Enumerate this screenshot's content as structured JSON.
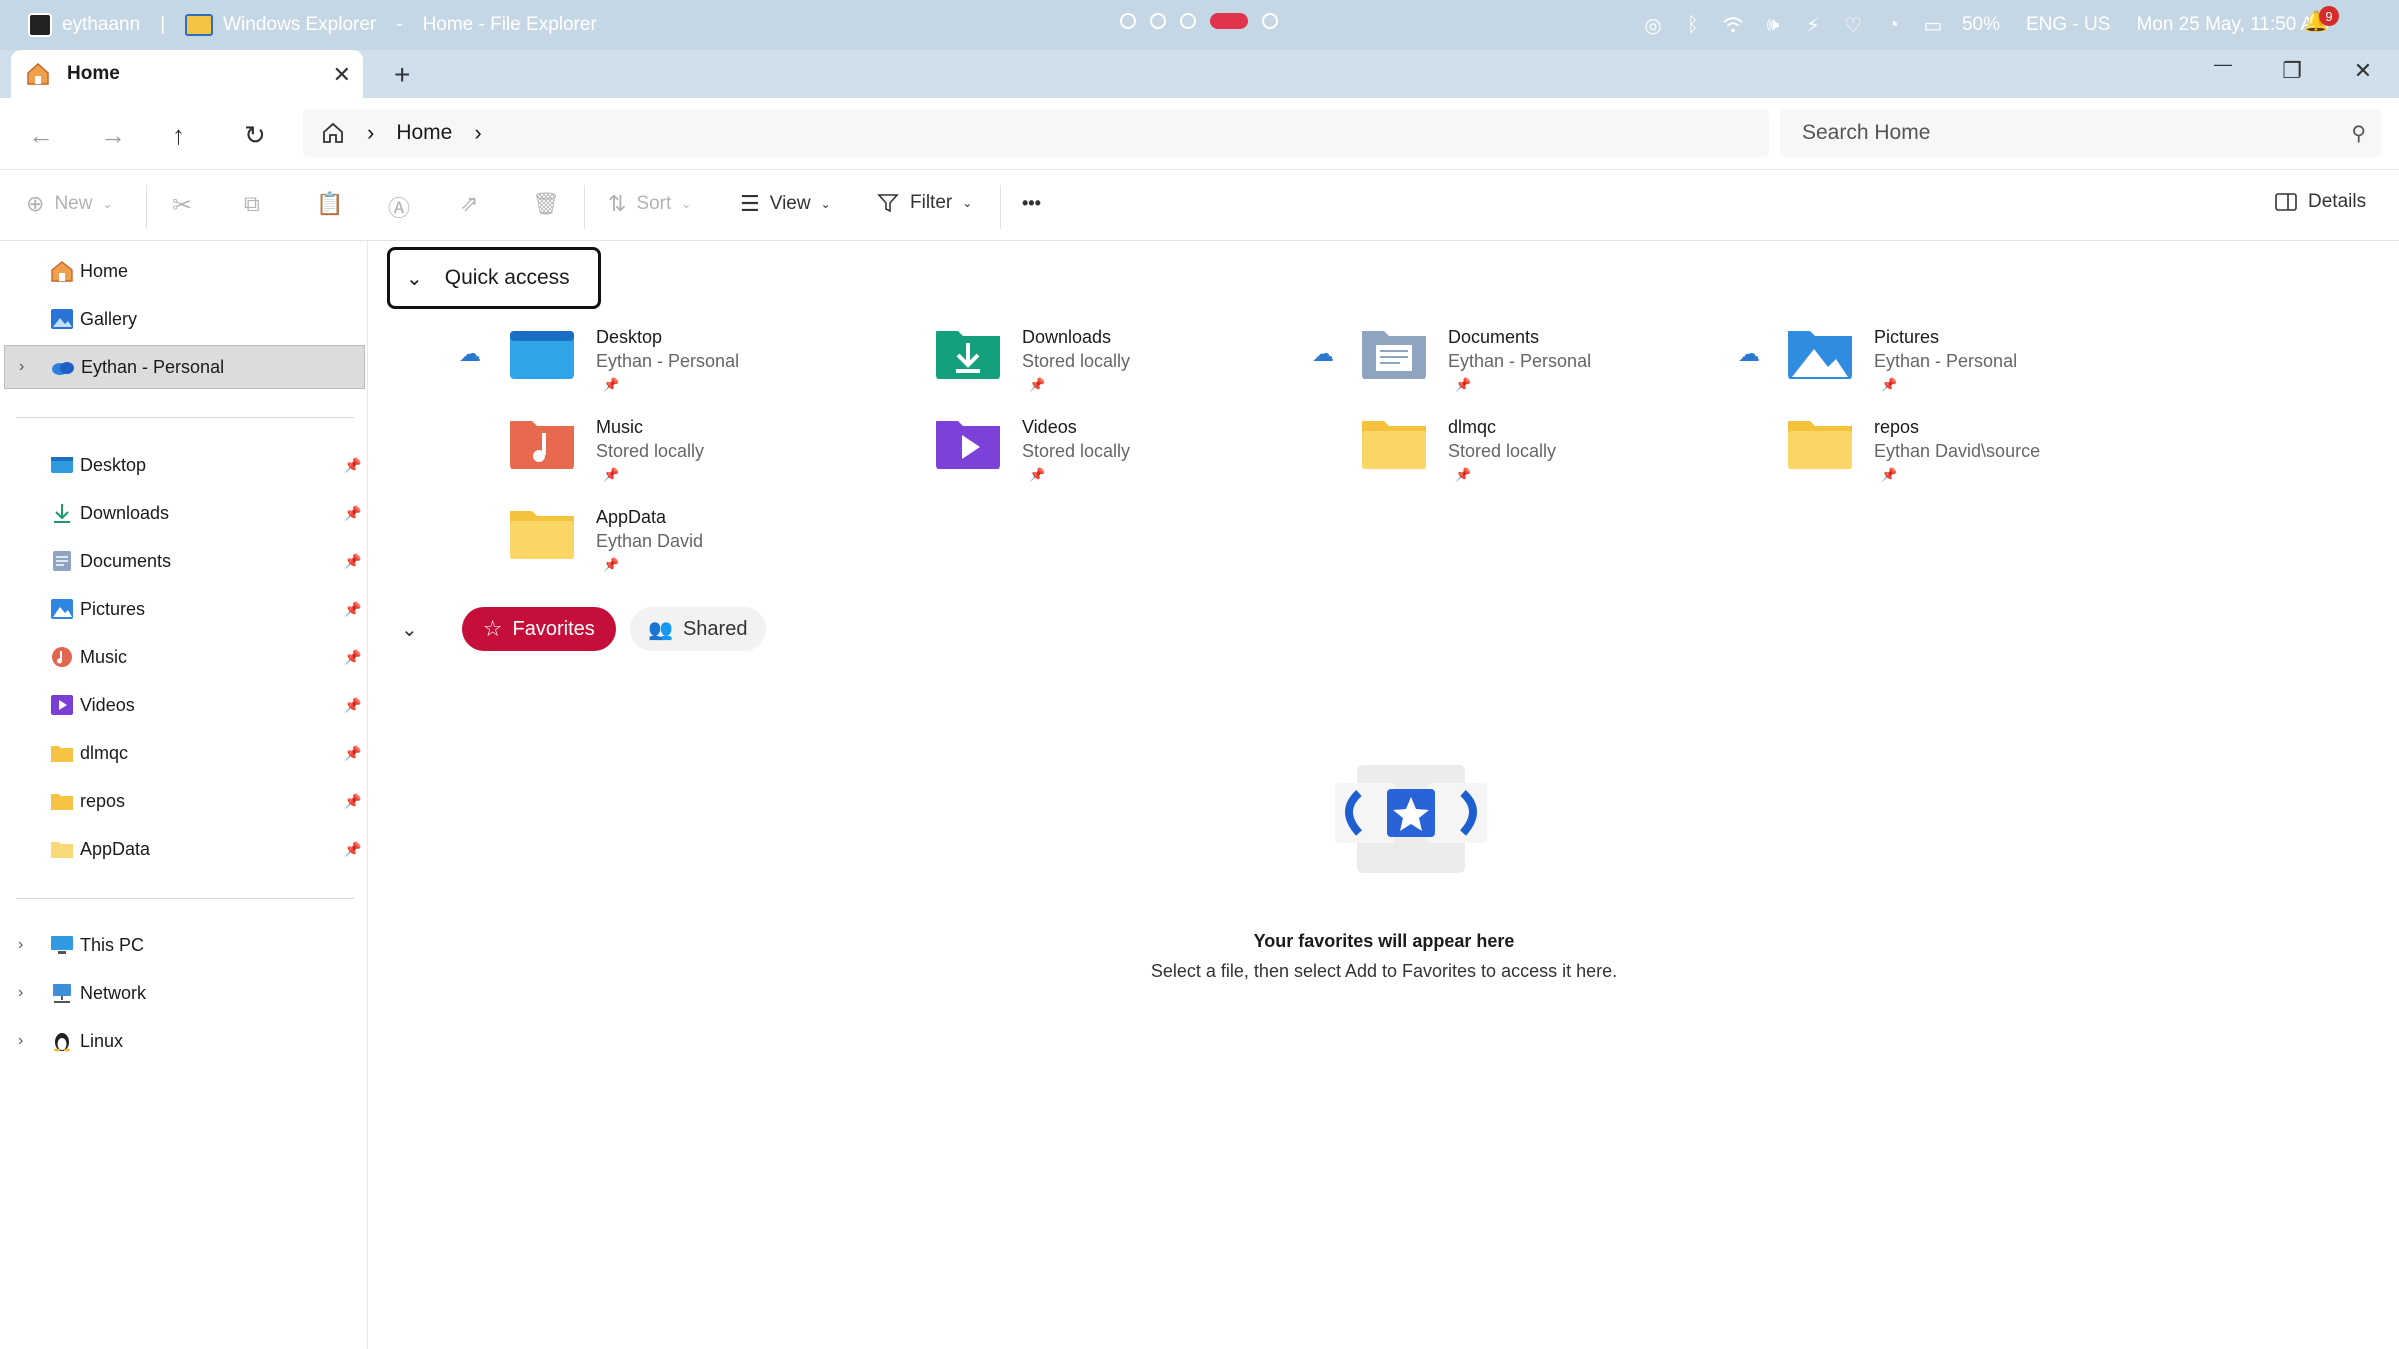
{
  "system_bar": {
    "user": "eythaann",
    "app_name": "Windows Explorer",
    "separator": "-",
    "window_title": "Home - File Explorer",
    "battery": "50%",
    "language": "ENG - US",
    "datetime": "Mon 25 May, 11:50 AM",
    "notification_count": "9"
  },
  "tab": {
    "label": "Home",
    "close": "✕",
    "new_tab": "+"
  },
  "window_controls": {
    "minimize": "—",
    "maximize": "❐",
    "close": "✕"
  },
  "address": {
    "breadcrumb": [
      "Home"
    ],
    "search_placeholder": "Search Home"
  },
  "toolbar": {
    "new": "New",
    "sort": "Sort",
    "view": "View",
    "filter": "Filter",
    "more": "•••",
    "details": "Details"
  },
  "sidebar": {
    "top": [
      {
        "label": "Home",
        "icon": "home-icon"
      },
      {
        "label": "Gallery",
        "icon": "gallery-icon"
      },
      {
        "label": "Eythan - Personal",
        "icon": "onedrive-icon"
      }
    ],
    "pinned": [
      {
        "label": "Desktop",
        "icon": "desktop-icon"
      },
      {
        "label": "Downloads",
        "icon": "downloads-icon"
      },
      {
        "label": "Documents",
        "icon": "documents-icon"
      },
      {
        "label": "Pictures",
        "icon": "pictures-icon"
      },
      {
        "label": "Music",
        "icon": "music-icon"
      },
      {
        "label": "Videos",
        "icon": "videos-icon"
      },
      {
        "label": "dlmqc",
        "icon": "folder-icon"
      },
      {
        "label": "repos",
        "icon": "folder-icon"
      },
      {
        "label": "AppData",
        "icon": "folder-icon"
      }
    ],
    "bottom": [
      {
        "label": "This PC",
        "icon": "pc-icon"
      },
      {
        "label": "Network",
        "icon": "network-icon"
      },
      {
        "label": "Linux",
        "icon": "linux-icon"
      }
    ]
  },
  "quick_access": {
    "title": "Quick access",
    "items": [
      {
        "name": "Desktop",
        "sub": "Eythan - Personal"
      },
      {
        "name": "Downloads",
        "sub": "Stored locally"
      },
      {
        "name": "Documents",
        "sub": "Eythan - Personal"
      },
      {
        "name": "Pictures",
        "sub": "Eythan - Personal"
      },
      {
        "name": "Music",
        "sub": "Stored locally"
      },
      {
        "name": "Videos",
        "sub": "Stored locally"
      },
      {
        "name": "dlmqc",
        "sub": "Stored locally"
      },
      {
        "name": "repos",
        "sub": "Eythan David\\source"
      },
      {
        "name": "AppData",
        "sub": "Eythan David"
      }
    ]
  },
  "favorites": {
    "tab_favorites": "Favorites",
    "tab_shared": "Shared",
    "empty_title": "Your favorites will appear here",
    "empty_sub": "Select a file, then select Add to Favorites to access it here."
  }
}
